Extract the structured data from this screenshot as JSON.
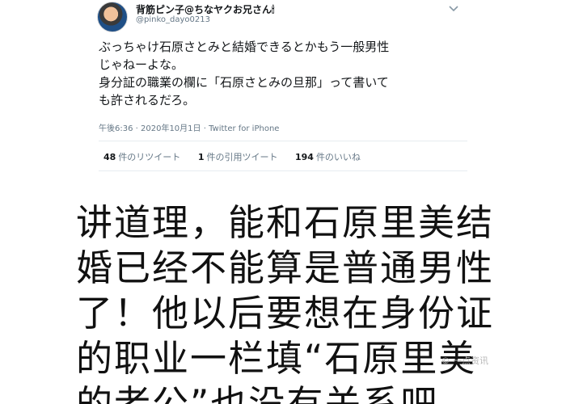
{
  "tweet": {
    "display_name": "背筋ピン子@ちなヤクお兄さん🕯",
    "handle": "@pinko_dayo0213",
    "lines": [
      "ぶっちゃけ石原さとみと結婚できるとかもう一般男性",
      "じゃねーよな。",
      "身分証の職業の欄に「石原さとみの旦那」って書いて",
      "も許されるだろ。"
    ],
    "meta": "午後6:36 · 2020年10月1日 · Twitter for iPhone",
    "stats": [
      {
        "count": "48",
        "label": "件のリツイート"
      },
      {
        "count": "1",
        "label": "件の引用ツイート"
      },
      {
        "count": "194",
        "label": "件のいいね"
      }
    ]
  },
  "caption": {
    "lines": [
      "讲道理，能和石原里美结",
      "婚已经不能算是普通男性",
      "了！他以后要想在身份证",
      "的职业一栏填“石原里美",
      "的老公”也没有关系吧"
    ]
  },
  "watermark": "© 一点资讯"
}
